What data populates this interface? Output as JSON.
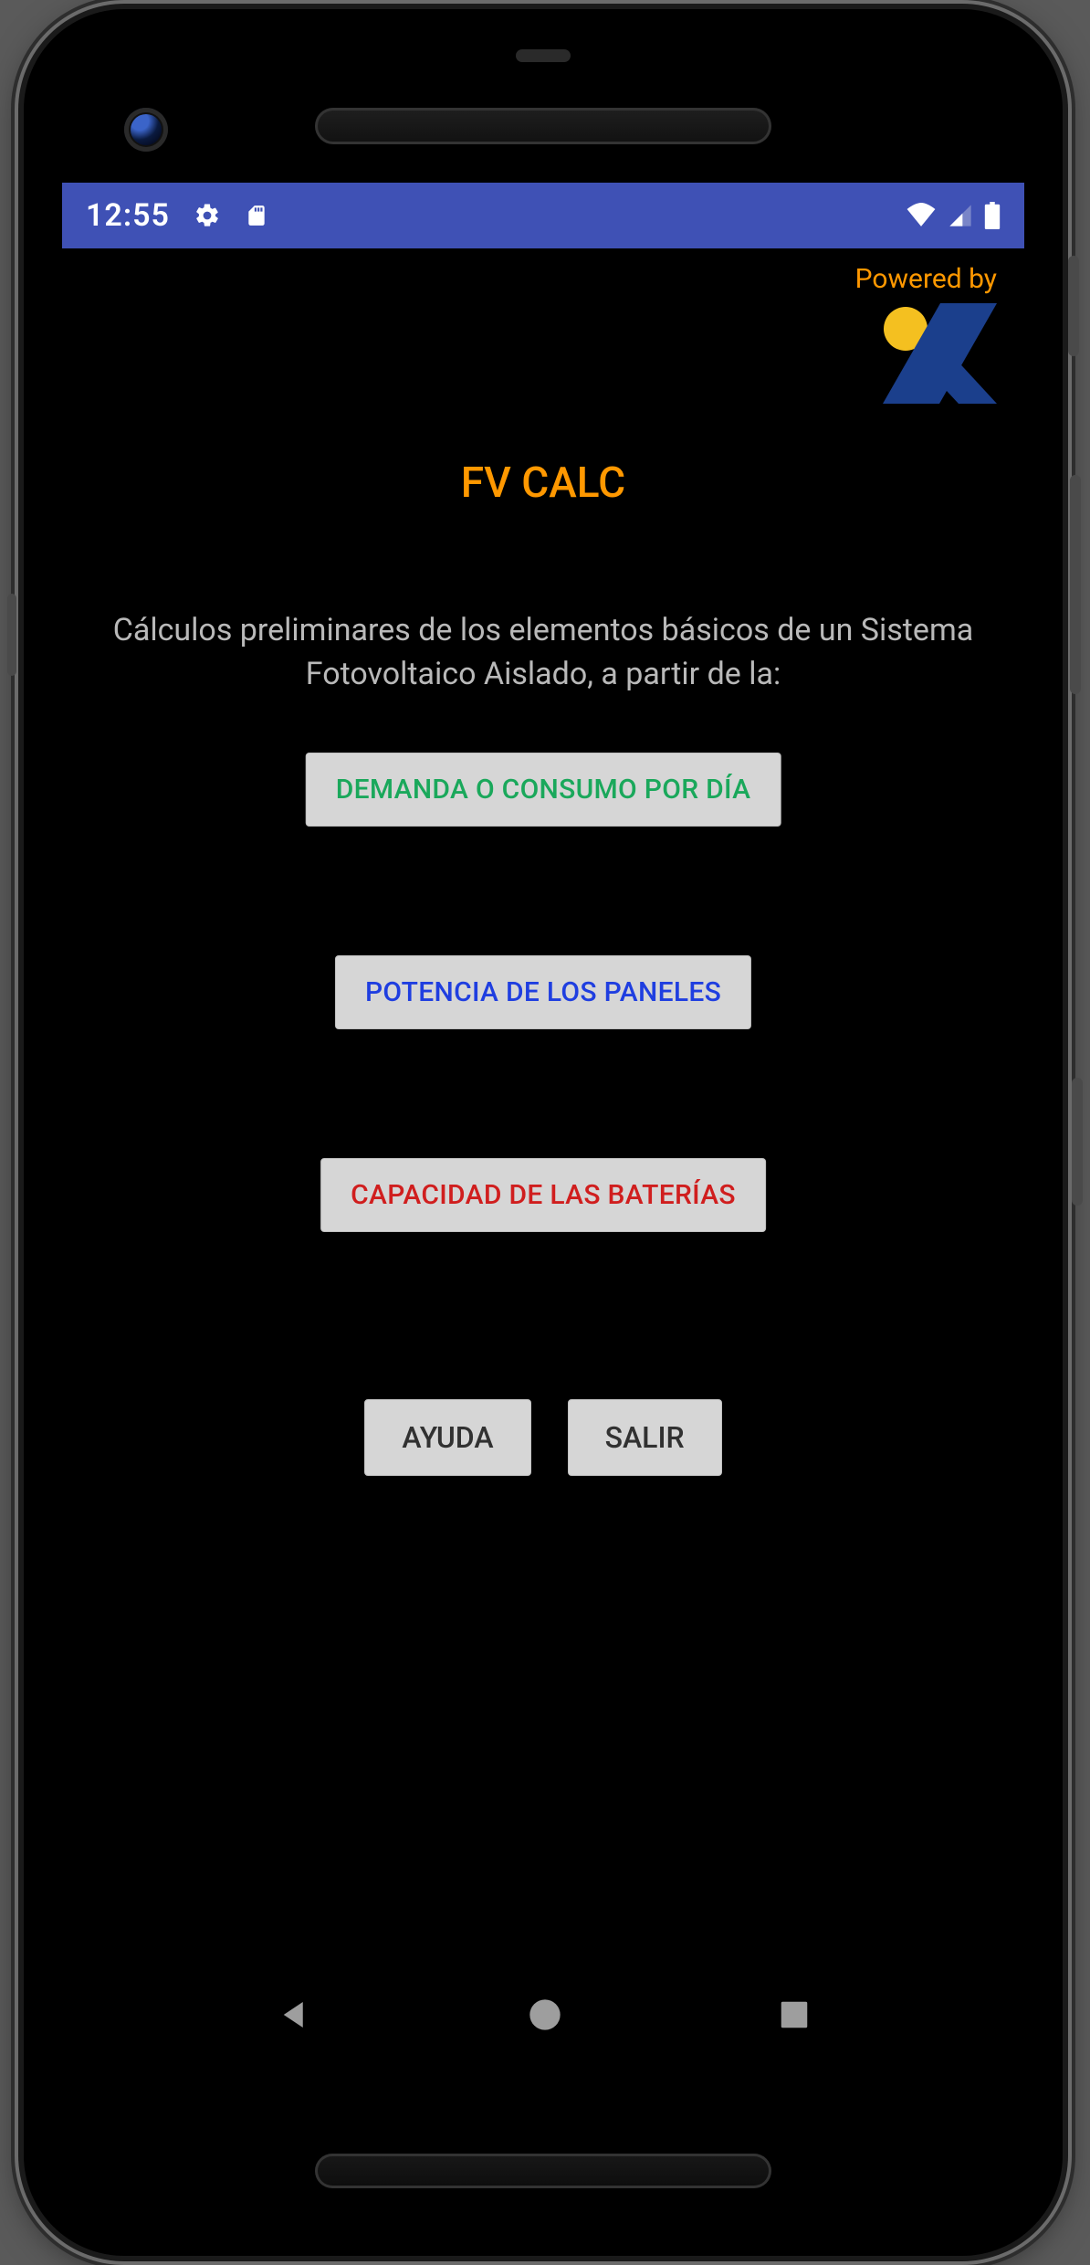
{
  "status": {
    "time": "12:55",
    "icons": {
      "settings": "gear",
      "sd": "sd-card",
      "wifi": "wifi",
      "signal": "cell",
      "battery": "battery-full"
    }
  },
  "powered_by": "Powered by",
  "app": {
    "title": "FV CALC",
    "subtitle": "Cálculos preliminares de los elementos básicos de un Sistema Fotovoltaico Aislado, a partir de la:"
  },
  "buttons": {
    "demand": "DEMANDA O CONSUMO POR DÍA",
    "potencia": "POTENCIA DE LOS PANELES",
    "baterias": "CAPACIDAD DE LAS BATERÍAS",
    "ayuda": "AYUDA",
    "salir": "SALIR"
  },
  "logo": {
    "accent": "#f4c020",
    "primary": "#1b3f8c"
  },
  "colors": {
    "statusbar": "#3f51b5",
    "accent_orange": "#ff9800",
    "btn_bg": "#d6d6d6",
    "btn_green": "#1aa85b",
    "btn_blue": "#1f3ee0",
    "btn_red": "#d01e1e"
  }
}
